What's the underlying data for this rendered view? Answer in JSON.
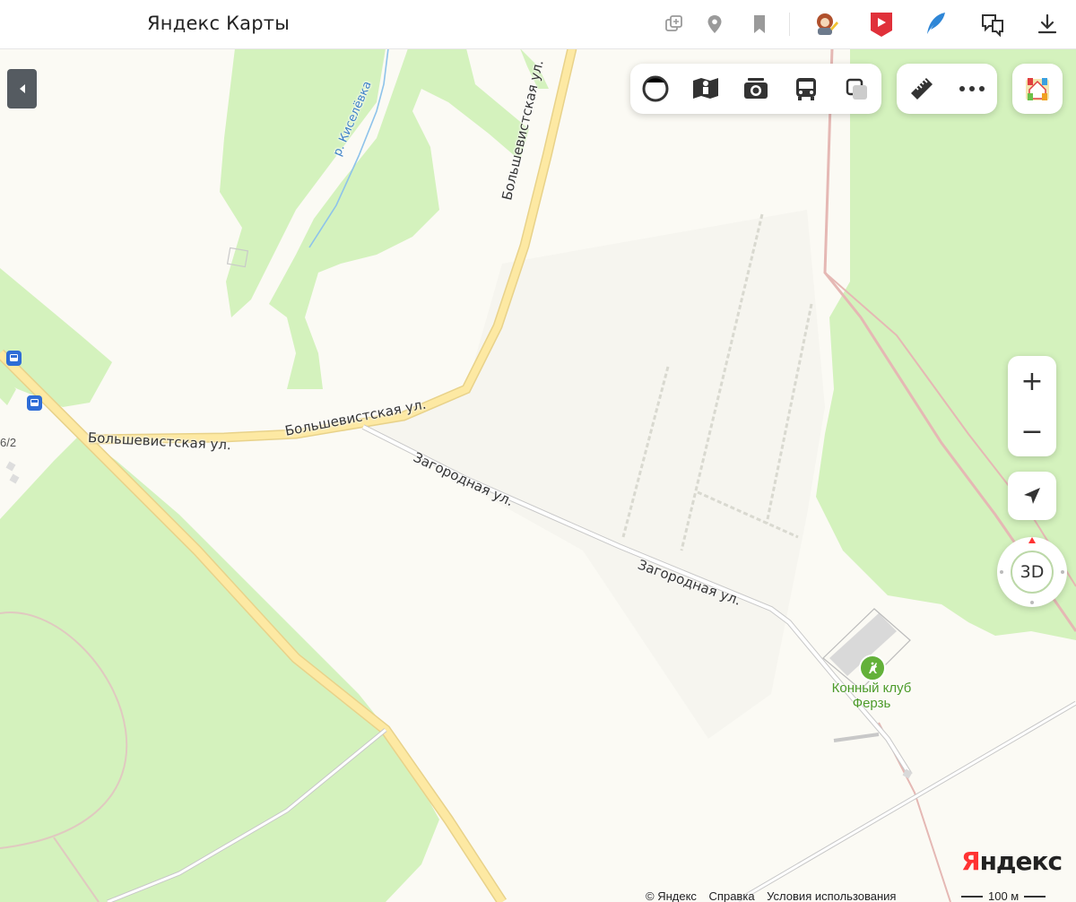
{
  "header": {
    "title": "Яндекс Карты",
    "icons": [
      "layers-add-icon",
      "place-marker-icon",
      "bookmark-icon",
      "avatar-icon",
      "video-play-icon",
      "feather-icon",
      "translate-icon",
      "download-icon"
    ]
  },
  "map": {
    "streets": [
      {
        "name": "Большевистская ул."
      },
      {
        "name": "Большевистская ул."
      },
      {
        "name": "Большевистская ул."
      },
      {
        "name": "Загородная ул."
      },
      {
        "name": "Загородная ул."
      }
    ],
    "river": "р. Киселёвка",
    "poi": {
      "name": "Конный клуб Ферзь",
      "category": "horse-riding"
    },
    "house_number": "6/2",
    "bus_stops": 2
  },
  "toolbar": {
    "buttons": [
      "panorama-button",
      "streetview-button",
      "photo-button",
      "transport-button",
      "layers-button"
    ],
    "tools": [
      "ruler-button",
      "more-button"
    ]
  },
  "controls": {
    "zoom_in": "+",
    "zoom_out": "−",
    "compass_label": "3D"
  },
  "footer": {
    "logo_y": "Я",
    "logo_rest": "ндекс",
    "copyright": "© Яндекс",
    "help": "Справка",
    "terms": "Условия использования",
    "scale": "100 м"
  },
  "colors": {
    "forest": "#d4f2bd",
    "road_major": "#fde9a3",
    "background": "#fbfaf4"
  }
}
